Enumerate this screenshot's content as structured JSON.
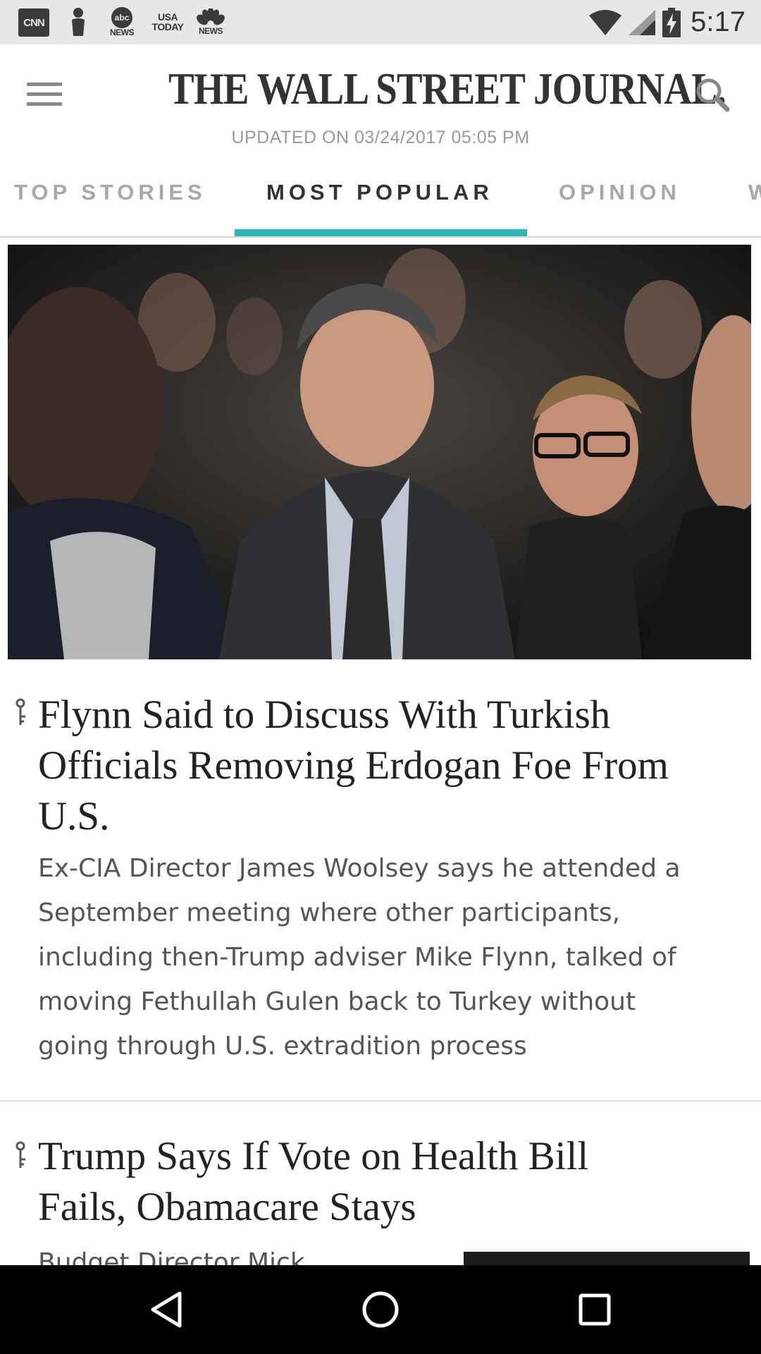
{
  "status_bar": {
    "notifications": [
      {
        "icon": "cnn-icon",
        "label": "CNN"
      },
      {
        "icon": "person-icon"
      },
      {
        "icon": "abc-news-icon",
        "label": "abc",
        "sub": "NEWS"
      },
      {
        "icon": "usa-today-icon",
        "label": "USA",
        "sub": "TODAY"
      },
      {
        "icon": "nbc-news-icon",
        "sub": "NEWS"
      }
    ],
    "time": "5:17",
    "system_icons": [
      "wifi-icon",
      "signal-icon",
      "battery-charging-icon"
    ]
  },
  "header": {
    "masthead": "THE WALL STREET JOURNAL.",
    "updated": "UPDATED ON 03/24/2017 05:05 PM",
    "menu_icon": "hamburger-menu-icon",
    "search_icon": "search-icon"
  },
  "tabs": [
    {
      "label": "TOP STORIES",
      "active": false
    },
    {
      "label": "MOST POPULAR",
      "active": true
    },
    {
      "label": "OPINION",
      "active": false
    },
    {
      "label": "W",
      "active": false
    }
  ],
  "articles": [
    {
      "has_image": true,
      "headline": "Flynn Said to Discuss With Turkish Officials Removing Erdogan Foe From U.S.",
      "summary": "Ex-CIA Director James Woolsey says he attended a September meeting where other participants, including then-Trump adviser Mike Flynn, talked of moving Fethullah Gulen back to Turkey without going through U.S. extradition process"
    },
    {
      "has_image": false,
      "headline": "Trump Says If Vote on Health Bill Fails, Obamacare Stays",
      "summary_partial": "Budget Director Mick"
    }
  ],
  "colors": {
    "accent": "#2bb7b3",
    "status_bar_bg": "#e5e8e4",
    "nav_bar_bg": "#000000"
  },
  "nav_bar": [
    "back-icon",
    "home-icon",
    "recents-icon"
  ]
}
